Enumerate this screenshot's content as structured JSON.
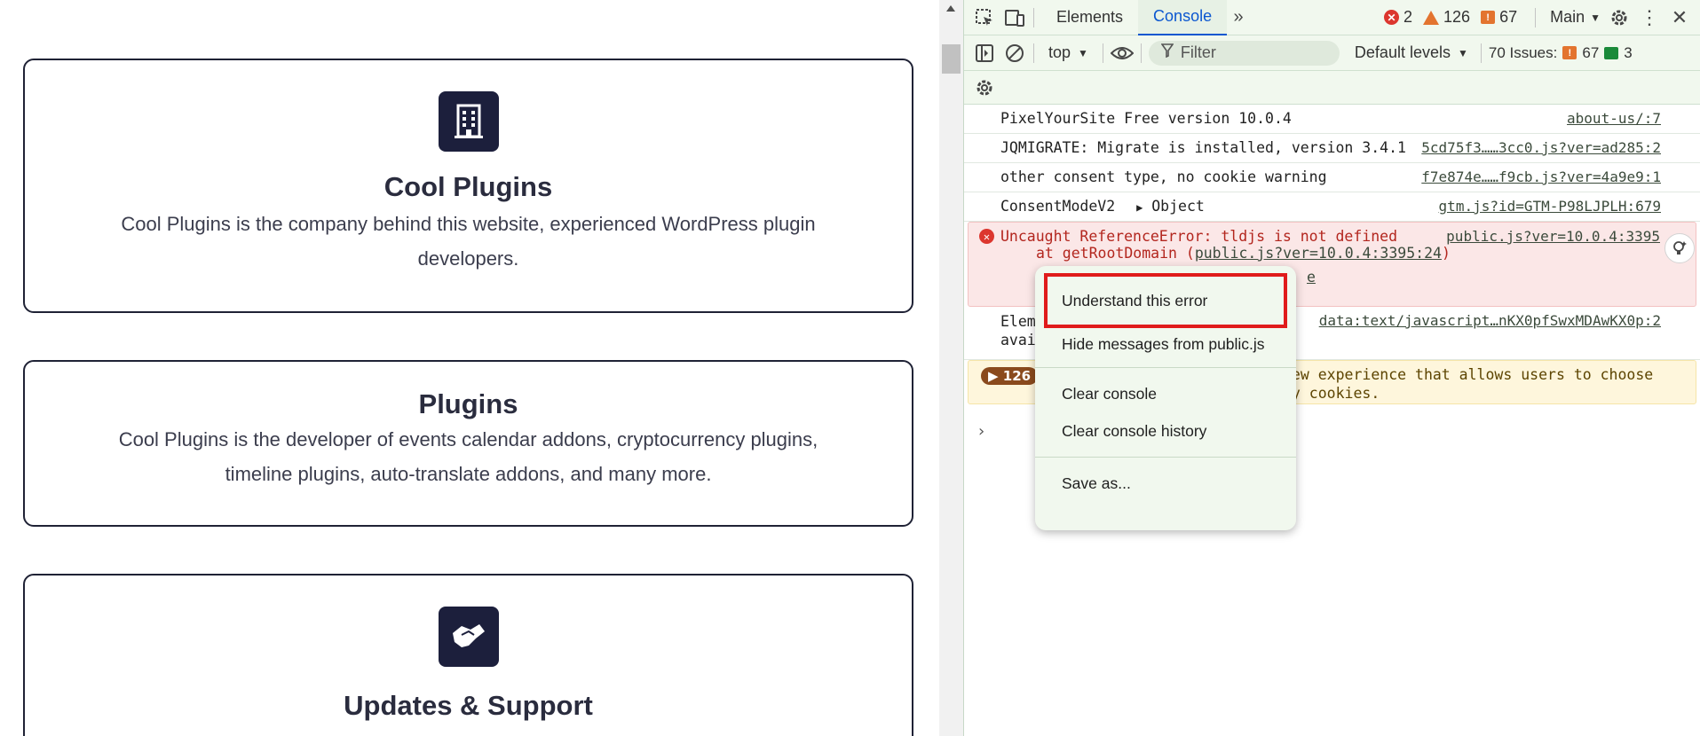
{
  "page": {
    "cards": [
      {
        "title": "Cool Plugins",
        "desc": "Cool Plugins is the company behind this website, experienced WordPress plugin developers.",
        "icon": "building-icon"
      },
      {
        "title": "Plugins",
        "desc": "Cool Plugins is the developer of events calendar addons, cryptocurrency plugins, timeline plugins, auto-translate addons, and many more."
      },
      {
        "title": "Updates & Support",
        "icon": "handshake-icon"
      }
    ]
  },
  "devtools": {
    "tabs": [
      "Elements",
      "Console"
    ],
    "active_tab": "Console",
    "counts": {
      "errors": "2",
      "warnings": "126",
      "issues": "67"
    },
    "target": "Main",
    "context": "top",
    "filter_placeholder": "Filter",
    "levels": "Default levels",
    "issues_label": "70 Issues:",
    "issues_count": "67",
    "messages_count": "3",
    "messages": [
      {
        "text": "PixelYourSite Free version 10.0.4",
        "src": "about-us/:7"
      },
      {
        "text": "JQMIGRATE: Migrate is installed, version 3.4.1",
        "src": "5cd75f3……3cc0.js?ver=ad285:2"
      },
      {
        "text": "other consent type, no cookie warning",
        "src": "f7e874e……f9cb.js?ver=4a9e9:1"
      },
      {
        "text": "ConsentModeV2",
        "object": "Object",
        "src": "gtm.js?id=GTM-P98LJPLH:679"
      }
    ],
    "error": {
      "text": "Uncaught ReferenceError: tldjs is not defined",
      "src": "public.js?ver=10.0.4:3395",
      "stack_prefix": "at getRootDomain (",
      "stack_link": "public.js?ver=10.0.4:3395:24",
      "stack_suffix": ")",
      "frag": "e"
    },
    "elem_row": {
      "line1": "Elem",
      "line2": "avai",
      "src": "data:text/javascript…nKX0pfSwxMDAwKX0p:2"
    },
    "warn_row": {
      "badge": "126",
      "line1": "new experience that allows users to choose",
      "line2": "ty cookies."
    }
  },
  "context_menu": {
    "items": [
      "Understand this error",
      "Hide messages from public.js",
      "Clear console",
      "Clear console history",
      "Save as..."
    ],
    "highlight_color": "#e01b1b"
  }
}
